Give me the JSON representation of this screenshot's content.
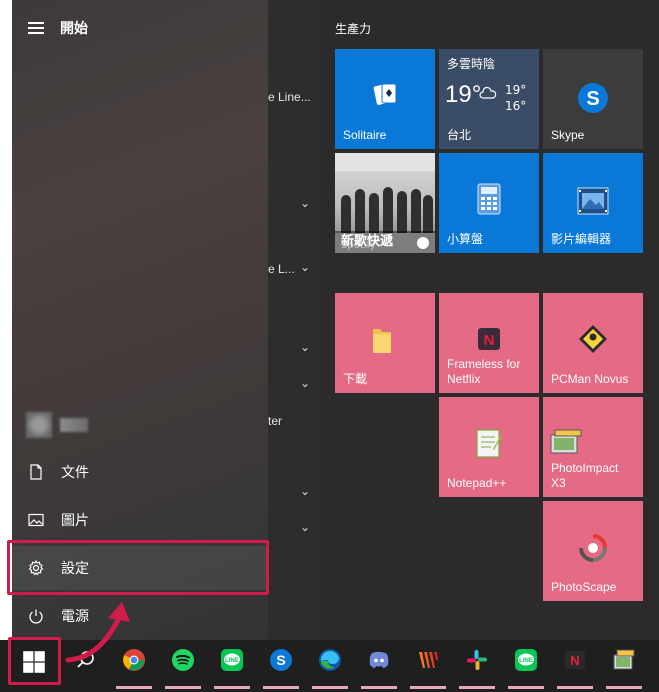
{
  "start": {
    "title": "開始"
  },
  "left_nav": {
    "documents": "文件",
    "pictures": "圖片",
    "settings": "設定",
    "power": "電源"
  },
  "app_list_fragments": [
    "e Line...",
    "e L...",
    "ter"
  ],
  "tile_group": {
    "title": "生產力",
    "tiles": [
      {
        "name": "Solitaire",
        "color": "#0a78d7"
      },
      {
        "name": "Skype",
        "color": "#0a78d7"
      },
      {
        "name": "小算盤",
        "color": "#0a78d7"
      },
      {
        "name": "影片編輯器",
        "color": "#0a78d7"
      },
      {
        "name": "下載",
        "color": "#e56a86"
      },
      {
        "name": "Frameless for Netflix",
        "line1": "Frameless for",
        "line2": "Netflix",
        "color": "#e56a86"
      },
      {
        "name": "PCMan Novus",
        "color": "#e56a86"
      },
      {
        "name": "Notepad++",
        "color": "#e56a86"
      },
      {
        "name": "PhotoImpact X3",
        "line1": "PhotoImpact",
        "line2": "X3",
        "color": "#e56a86"
      },
      {
        "name": "PhotoScape",
        "color": "#e56a86"
      }
    ],
    "weather": {
      "condition": "多雲時陰",
      "temp": "19°",
      "high": "19°",
      "low": "16°",
      "city": "台北"
    },
    "spotify": {
      "banner": "新歌快遞",
      "app": "Spotify"
    }
  },
  "taskbar": {
    "icons": [
      "windows-start-icon",
      "search-icon",
      "chrome-icon",
      "spotify-icon",
      "line-icon",
      "skype-icon",
      "edge-icon",
      "discord-icon",
      "winamp-icon",
      "slack-icon",
      "line-icon",
      "netflix-icon",
      "photoimpact-icon"
    ]
  },
  "colors": {
    "highlight": "#cf1c4a",
    "tile_blue": "#0a78d7",
    "tile_pink": "#e56a86"
  }
}
